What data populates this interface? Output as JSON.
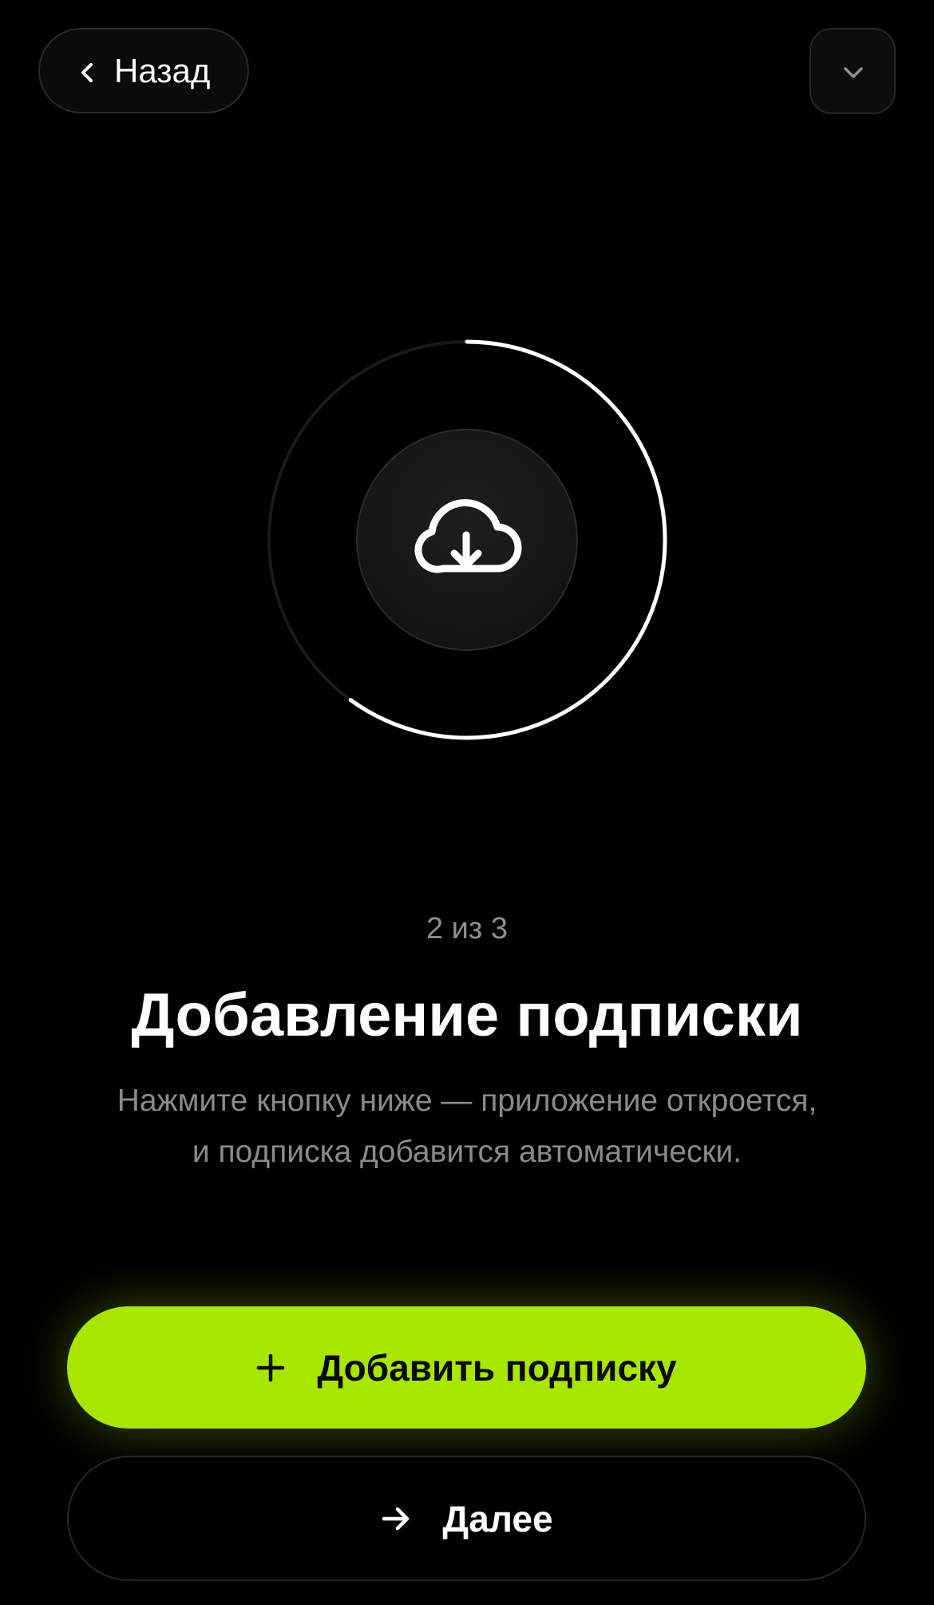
{
  "header": {
    "back_label": "Назад",
    "back_icon": "chevron-left-icon",
    "menu_icon": "chevron-down-icon"
  },
  "hero": {
    "icon": "cloud-download-icon",
    "progress_fraction": 0.6
  },
  "content": {
    "step_counter": "2 из 3",
    "title": "Добавление подписки",
    "description_line1": "Нажмите кнопку ниже — приложение откроется,",
    "description_line2": "и подписка добавится автоматически."
  },
  "actions": {
    "primary_label": "Добавить подписку",
    "primary_icon": "plus-icon",
    "secondary_label": "Далее",
    "secondary_icon": "arrow-right-icon"
  },
  "colors": {
    "background": "#000000",
    "accent": "#a8e600",
    "text_primary": "#ffffff",
    "text_secondary": "#8a8a8a"
  }
}
